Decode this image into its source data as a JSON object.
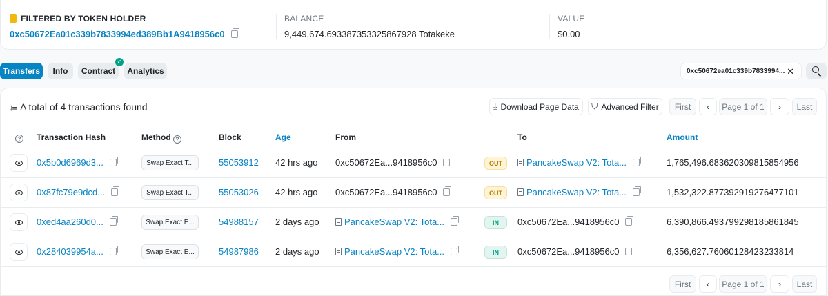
{
  "holder": {
    "label": "FILTERED BY TOKEN HOLDER",
    "address": "0xc50672Ea01c339b7833994ed389Bb1A9418956c0",
    "balance_label": "BALANCE",
    "balance_value": "9,449,674.693387353325867928 Totakeke",
    "value_label": "VALUE",
    "value_value": "$0.00"
  },
  "tabs": [
    {
      "label": "Transfers",
      "active": true
    },
    {
      "label": "Info"
    },
    {
      "label": "Contract",
      "verified": true
    },
    {
      "label": "Analytics"
    }
  ],
  "filter_chip": "0xc50672ea01c339b7833994...",
  "summary": "A total of 4 transactions found",
  "buttons": {
    "download": "Download Page Data",
    "advanced_filter": "Advanced Filter",
    "first": "First",
    "page": "Page 1 of 1",
    "last": "Last"
  },
  "columns": {
    "hash": "Transaction Hash",
    "method": "Method",
    "block": "Block",
    "age": "Age",
    "from": "From",
    "to": "To",
    "amount": "Amount"
  },
  "rows": [
    {
      "hash": "0x5b0d6969d3...",
      "method": "Swap Exact T...",
      "block": "55053912",
      "age": "42 hrs ago",
      "from": "0xc50672Ea...9418956c0",
      "dir": "OUT",
      "to": "PancakeSwap V2: Tota...",
      "amount": "1,765,496.683620309815854956"
    },
    {
      "hash": "0x87fc79e9dcd...",
      "method": "Swap Exact T...",
      "block": "55053026",
      "age": "42 hrs ago",
      "from": "0xc50672Ea...9418956c0",
      "dir": "OUT",
      "to": "PancakeSwap V2: Tota...",
      "amount": "1,532,322.877392919276477101"
    },
    {
      "hash": "0xed4aa260d0...",
      "method": "Swap Exact E...",
      "block": "54988157",
      "age": "2 days ago",
      "from": "PancakeSwap V2: Tota...",
      "dir": "IN",
      "to": "0xc50672Ea...9418956c0",
      "amount": "6,390,866.493799298185861845"
    },
    {
      "hash": "0x284039954a...",
      "method": "Swap Exact E...",
      "block": "54987986",
      "age": "2 days ago",
      "from": "PancakeSwap V2: Tota...",
      "dir": "IN",
      "to": "0xc50672Ea...9418956c0",
      "amount": "6,356,627.76060128423233814"
    }
  ],
  "colors": {
    "accent": "#0784c3",
    "out": "#b47d00",
    "in": "#00a186"
  }
}
